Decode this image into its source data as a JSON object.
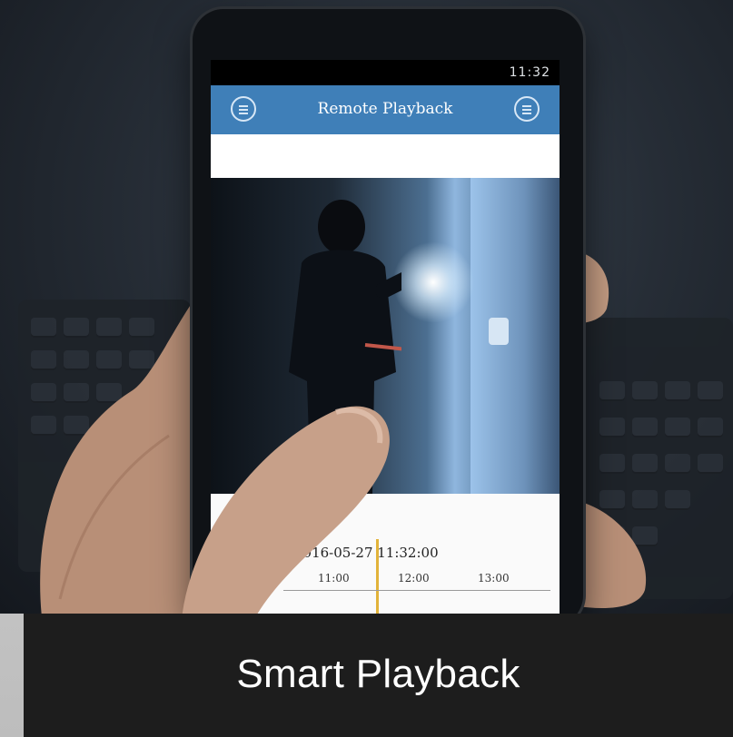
{
  "phone": {
    "status_time": "11:32",
    "app_title": "Remote Playback",
    "timeline": {
      "current_datetime": "2016-05-27 11:32:00",
      "ticks": [
        "11:00",
        "12:00",
        "13:00"
      ]
    }
  },
  "caption": "Smart Playback",
  "icons": [
    "menu-icon",
    "share-icon"
  ],
  "colors": {
    "app_bar": "#3f7fb8",
    "caption_bg": "#1d1d1d",
    "playhead": "#e2b33a"
  }
}
